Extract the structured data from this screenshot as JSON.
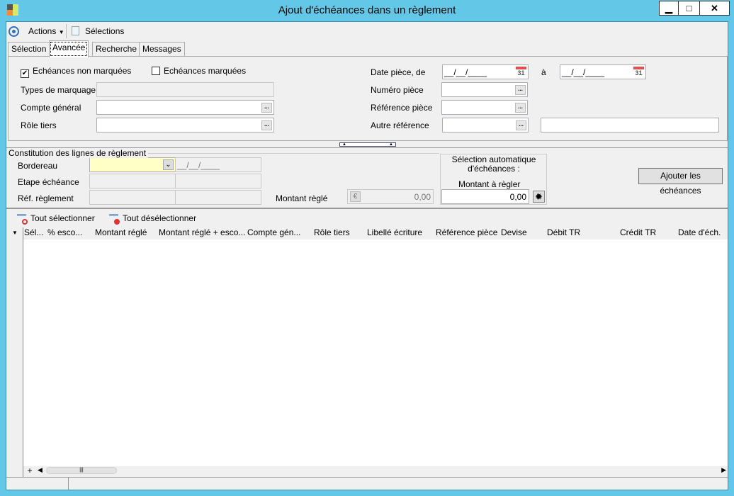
{
  "window": {
    "title": "Ajout d'échéances dans un règlement",
    "minimize": "▁",
    "maximize": "□",
    "close": "✕"
  },
  "toolbar": {
    "actions": "Actions",
    "selections": "Sélections"
  },
  "tabs": [
    "Sélection",
    "Avancée",
    "Recherche",
    "Messages"
  ],
  "active_tab": "Avancée",
  "filters": {
    "unmarked_label": "Echéances non marquées",
    "unmarked_checked": true,
    "marked_label": "Echéances marquées",
    "marked_checked": false,
    "types_marquage": "Types de marquage",
    "compte_general": "Compte général",
    "role_tiers": "Rôle tiers",
    "date_piece": "Date pièce, de",
    "date_from": "__/__/____",
    "a": "à",
    "date_to": "__/__/____",
    "numero_piece": "Numéro pièce",
    "reference_piece": "Référence pièce",
    "autre_reference": "Autre référence",
    "calendar": "31",
    "ellipsis": "..."
  },
  "constitution": {
    "title": "Constitution des lignes de règlement",
    "bordereau": "Bordereau",
    "bordereau_date": "__/__/____",
    "etape": "Etape échéance",
    "ref_reglement": "Réf. règlement",
    "montant_regle": "Montant règlé",
    "montant_regle_value": "0,00",
    "auto_title": "Sélection automatique d'échéances :",
    "montant_a_regler": "Montant à règler",
    "montant_a_regler_value": "0,00",
    "add_button": "Ajouter les échéances"
  },
  "grid": {
    "select_all": "Tout sélectionner",
    "deselect_all": "Tout désélectionner",
    "columns": [
      "Sél...",
      "% esco...",
      "Montant réglé",
      "Montant réglé + esco...",
      "Compte gén...",
      "Rôle tiers",
      "Libellé écriture",
      "Référence pièce",
      "Devise",
      "Débit TR",
      "Crédit TR",
      "Date d'éch."
    ],
    "add": "+"
  }
}
